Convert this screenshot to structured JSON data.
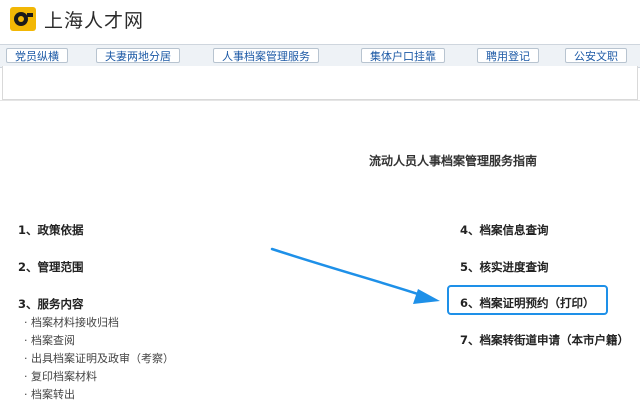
{
  "site": {
    "name": "上海人才网"
  },
  "nav": {
    "items": [
      {
        "label": "党员纵横"
      },
      {
        "label": "夫妻两地分居"
      },
      {
        "label": "人事档案管理服务"
      },
      {
        "label": "集体户口挂靠"
      },
      {
        "label": "聘用登记"
      },
      {
        "label": "公安文职"
      }
    ]
  },
  "guide": {
    "title": "流动人员人事档案管理服务指南",
    "left": [
      {
        "label": "1、政策依据"
      },
      {
        "label": "2、管理范围"
      },
      {
        "label": "3、服务内容"
      }
    ],
    "service_items": [
      "· 档案材料接收归档",
      "· 档案查阅",
      "· 出具档案证明及政审（考察）",
      "· 复印档案材料",
      "· 档案转出"
    ],
    "right": [
      {
        "label": "4、档案信息查询"
      },
      {
        "label": "5、核实进度查询"
      },
      {
        "label": "6、档案证明预约（打印）"
      },
      {
        "label": "7、档案转街道申请（本市户籍）"
      }
    ]
  },
  "colors": {
    "highlight": "#1e90e8",
    "nav_text": "#1d5aa6",
    "logo_yellow": "#f2b705"
  },
  "icons": {
    "logo": "site-logo-icon",
    "annotation": "annotation-arrow-icon"
  }
}
